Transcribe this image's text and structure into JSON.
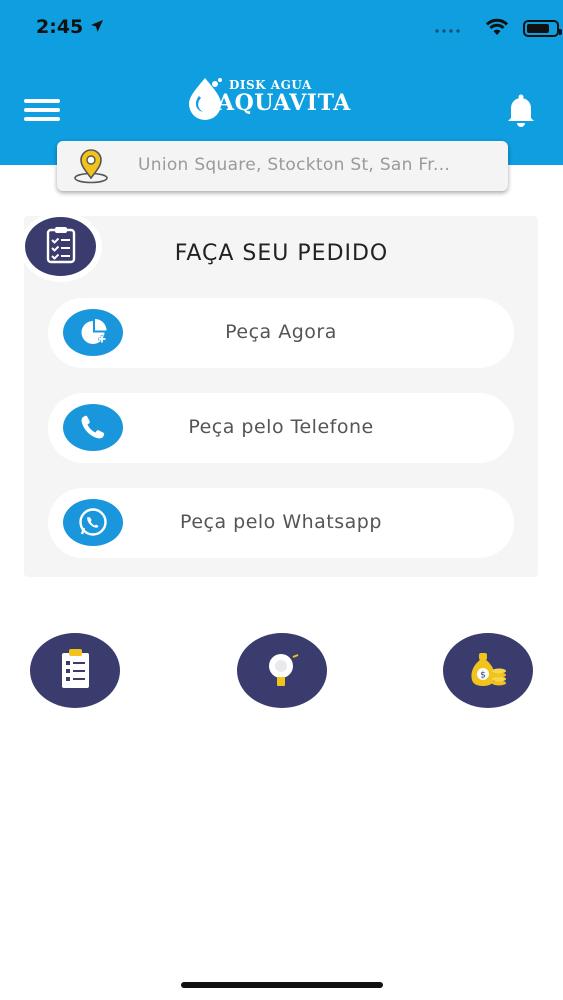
{
  "status_bar": {
    "time": "2:45"
  },
  "header": {
    "logo_small": "DISK AGUA",
    "logo_big": "AQUAVITA"
  },
  "location": {
    "text": "Union Square, Stockton St, San Fr..."
  },
  "order_card": {
    "title": "FAÇA SEU PEDIDO",
    "options": [
      {
        "label": "Peça Agora",
        "icon": "pie-chart-plus-icon"
      },
      {
        "label": "Peça pelo Telefone",
        "icon": "phone-icon"
      },
      {
        "label": "Peça pelo Whatsapp",
        "icon": "whatsapp-icon"
      }
    ]
  },
  "quick_actions": [
    {
      "icon": "clipboard-list-icon"
    },
    {
      "icon": "water-dispenser-icon"
    },
    {
      "icon": "money-bag-coins-icon"
    }
  ],
  "colors": {
    "header_blue": "#0f9ee0",
    "accent_blue": "#1a97dc",
    "navy": "#3a3c6e",
    "card_bg": "#f6f5f6"
  }
}
